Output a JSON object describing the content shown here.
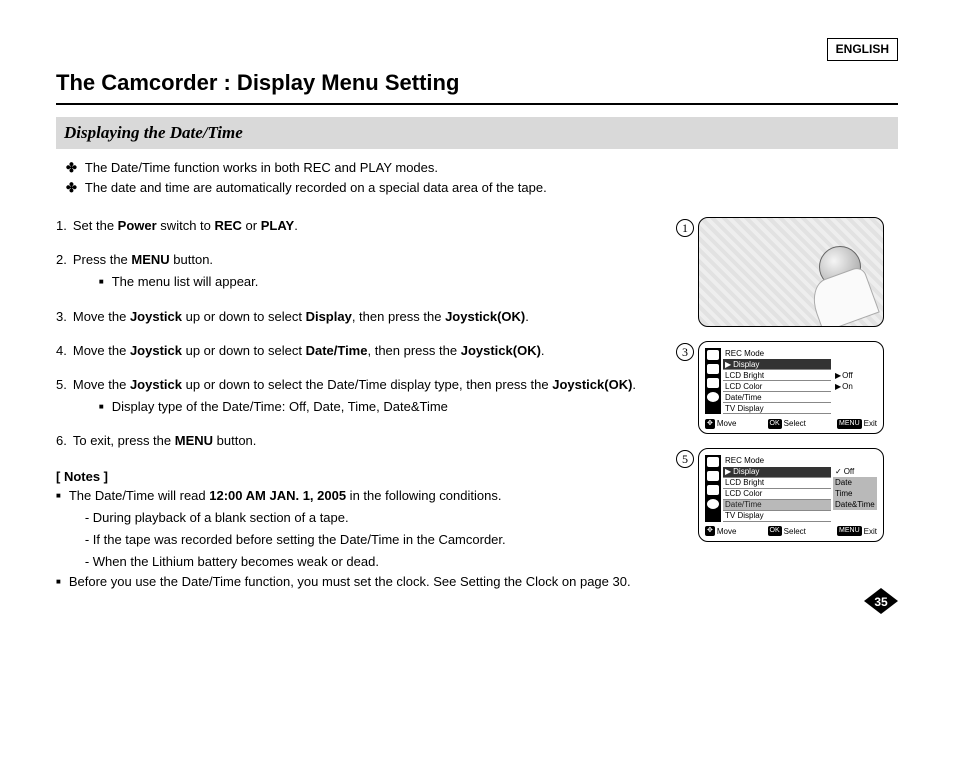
{
  "lang_tag": "ENGLISH",
  "title": "The Camcorder : Display Menu Setting",
  "section_heading": "Displaying the Date/Time",
  "intro": [
    "The Date/Time function works in both REC and PLAY modes.",
    "The date and time are automatically recorded on a special data area of the tape."
  ],
  "steps": [
    {
      "text": "Set the <b>Power</b> switch to <b>REC</b> or <b>PLAY</b>."
    },
    {
      "text": "Press the <b>MENU</b> button.",
      "sub": "The menu list will appear."
    },
    {
      "text": "Move the <b>Joystick</b> up or down to select <b>Display</b>, then press the <b>Joystick(OK)</b>."
    },
    {
      "text": "Move the <b>Joystick</b> up or down to select <b>Date/Time</b>, then press the <b>Joystick(OK)</b>."
    },
    {
      "text": "Move the <b>Joystick</b> up or down to select the Date/Time display type, then press the <b>Joystick(OK)</b>.",
      "sub": "Display type of the Date/Time: Off, Date, Time, Date&Time"
    },
    {
      "text": "To exit, press the <b>MENU</b> button."
    }
  ],
  "notes_head": "[ Notes ]",
  "notes": [
    {
      "text": "The Date/Time will read <b>12:00 AM JAN. 1, 2005</b> in the following conditions.",
      "subs": [
        "- During playback of a blank section of a tape.",
        "- If the tape was recorded before setting the Date/Time in the Camcorder.",
        "- When the Lithium battery becomes weak or dead."
      ]
    },
    {
      "text": "Before you use the Date/Time function, you must set the clock. See Setting the Clock on page 30."
    }
  ],
  "fig_numbers": {
    "one": "1",
    "three": "3",
    "five": "5"
  },
  "menu3": {
    "mode": "REC Mode",
    "items": [
      "Display",
      "LCD Bright",
      "LCD Color",
      "Date/Time",
      "TV Display"
    ],
    "options": [
      "Off",
      "On"
    ]
  },
  "menu5": {
    "mode": "REC Mode",
    "items": [
      "Display",
      "LCD Bright",
      "LCD Color",
      "Date/Time",
      "TV Display"
    ],
    "options": [
      "Off",
      "Date",
      "Time",
      "Date&Time"
    ]
  },
  "footer": {
    "move": "Move",
    "select": "Select",
    "exit": "Exit",
    "ok": "OK",
    "menu": "MENU"
  },
  "page_number": "35"
}
